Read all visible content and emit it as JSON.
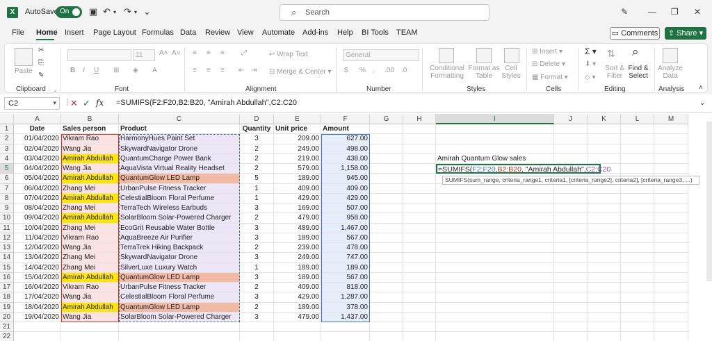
{
  "titlebar": {
    "autosave_label": "AutoSave",
    "autosave_state": "On",
    "search_placeholder": "Search"
  },
  "tabs": [
    "File",
    "Home",
    "Insert",
    "Page Layout",
    "Formulas",
    "Data",
    "Review",
    "View",
    "Automate",
    "Add-ins",
    "Help",
    "BI Tools",
    "TEAM"
  ],
  "actions": {
    "comments": "Comments",
    "share": "Share"
  },
  "ribbon": {
    "groups": [
      "Clipboard",
      "Font",
      "Alignment",
      "Number",
      "Styles",
      "Cells",
      "Editing",
      "Analysis"
    ],
    "paste": "Paste",
    "font_size": "11",
    "wrap_text": "Wrap Text",
    "merge_center": "Merge & Center",
    "number_format": "General",
    "conditional_formatting": "Conditional Formatting",
    "format_as_table": "Format as Table",
    "cell_styles": "Cell Styles",
    "insert": "Insert",
    "delete": "Delete",
    "format": "Format",
    "sort_filter": "Sort & Filter",
    "find_select": "Find & Select",
    "analyze_data": "Analyze Data"
  },
  "formula_bar": {
    "name_box": "C2",
    "formula": "=SUMIFS(F2:F20,B2:B20, \"Amirah Abdullah\",C2:C20"
  },
  "columns": [
    "A",
    "B",
    "C",
    "D",
    "E",
    "F",
    "G",
    "H",
    "I",
    "J",
    "K",
    "L",
    "M"
  ],
  "rows": [
    "1",
    "2",
    "3",
    "4",
    "5",
    "6",
    "7",
    "8",
    "9",
    "10",
    "11",
    "12",
    "13",
    "14",
    "15",
    "16",
    "17",
    "18",
    "19",
    "20",
    "21",
    "22"
  ],
  "table": {
    "headers": [
      "Date",
      "Sales person",
      "Product",
      "Quantity",
      "Unit price",
      "Amount"
    ],
    "data": [
      [
        "01/04/2020",
        "Vikram Rao",
        "HarmonyHues Paint Set",
        "3",
        "209.00",
        "627.00"
      ],
      [
        "02/04/2020",
        "Wang Jia",
        "SkywardNavigator Drone",
        "2",
        "249.00",
        "498.00"
      ],
      [
        "03/04/2020",
        "Amirah Abdullah",
        "QuantumCharge Power Bank",
        "2",
        "219.00",
        "438.00"
      ],
      [
        "04/04/2020",
        "Wang Jia",
        "AquaVista Virtual Reality Headset",
        "2",
        "579.00",
        "1,158.00"
      ],
      [
        "05/04/2020",
        "Amirah Abdullah",
        "QuantumGlow LED Lamp",
        "5",
        "189.00",
        "945.00"
      ],
      [
        "06/04/2020",
        "Zhang Mei",
        "UrbanPulse Fitness Tracker",
        "1",
        "409.00",
        "409.00"
      ],
      [
        "07/04/2020",
        "Amirah Abdullah",
        "CelestialBloom Floral Perfume",
        "1",
        "429.00",
        "429.00"
      ],
      [
        "08/04/2020",
        "Zhang Mei",
        "TerraTech Wireless Earbuds",
        "3",
        "169.00",
        "507.00"
      ],
      [
        "09/04/2020",
        "Amirah Abdullah",
        "SolarBloom Solar-Powered Charger",
        "2",
        "479.00",
        "958.00"
      ],
      [
        "10/04/2020",
        "Zhang Mei",
        "EcoGrit Reusable Water Bottle",
        "3",
        "489.00",
        "1,467.00"
      ],
      [
        "11/04/2020",
        "Vikram Rao",
        "AquaBreeze Air Purifier",
        "3",
        "189.00",
        "567.00"
      ],
      [
        "12/04/2020",
        "Wang Jia",
        "TerraTrek Hiking Backpack",
        "2",
        "239.00",
        "478.00"
      ],
      [
        "13/04/2020",
        "Zhang Mei",
        "SkywardNavigator Drone",
        "3",
        "249.00",
        "747.00"
      ],
      [
        "14/04/2020",
        "Zhang Mei",
        "SilverLuxe Luxury Watch",
        "1",
        "189.00",
        "189.00"
      ],
      [
        "15/04/2020",
        "Amirah Abdullah",
        "QuantumGlow LED Lamp",
        "3",
        "189.00",
        "567.00"
      ],
      [
        "16/04/2020",
        "Vikram Rao",
        "UrbanPulse Fitness Tracker",
        "2",
        "409.00",
        "818.00"
      ],
      [
        "17/04/2020",
        "Wang Jia",
        "CelestialBloom Floral Perfume",
        "3",
        "429.00",
        "1,287.00"
      ],
      [
        "18/04/2020",
        "Amirah Abdullah",
        "QuantumGlow LED Lamp",
        "2",
        "189.00",
        "378.00"
      ],
      [
        "19/04/2020",
        "Wang Jia",
        "SolarBloom Solar-Powered Charger",
        "3",
        "479.00",
        "1,437.00"
      ]
    ]
  },
  "side": {
    "label": "Amirah Quantum Glow sales",
    "formula_parts": [
      "=SUMIFS(",
      "F2:F20",
      ",",
      "B2:B20",
      ", \"Amirah Abdullah\",",
      "C2:C20"
    ],
    "tooltip": "SUMIFS(sum_range, criteria_range1, criteria1, [criteria_range2], criteria2], [criteria_range3, ...)"
  },
  "colors": {
    "excel_green": "#1f7244",
    "ref_blue": "#3a6fd8",
    "ref_red": "#c0392b",
    "ref_purple": "#7a5bbf",
    "highlight_yellow": "#ffe600",
    "highlight_salmon": "#f2baa5"
  }
}
